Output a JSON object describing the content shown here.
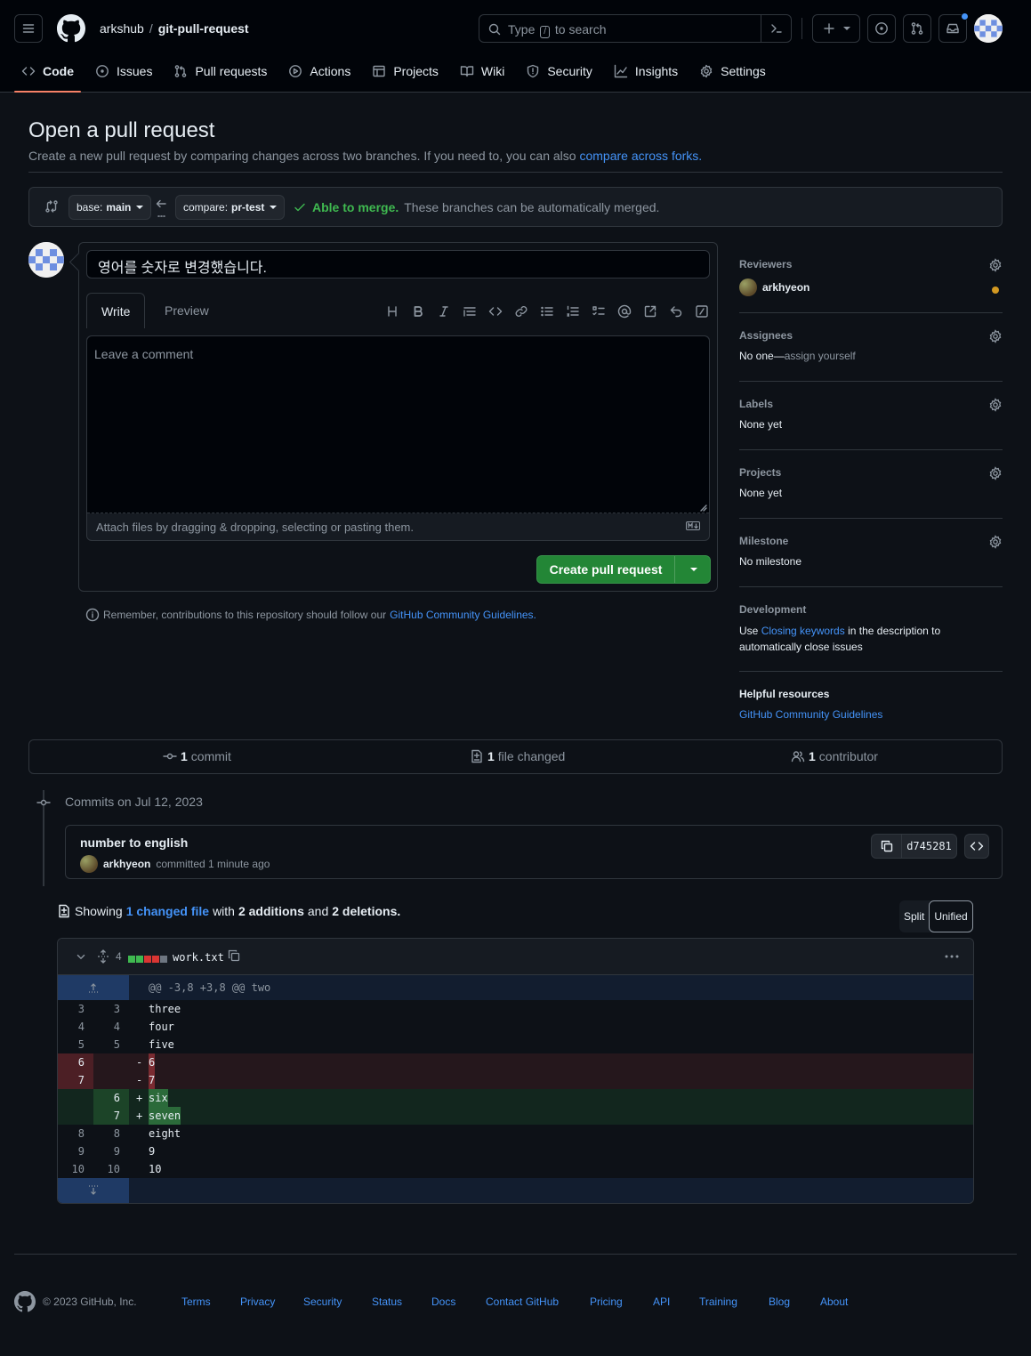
{
  "header": {
    "owner": "arkshub",
    "repo": "git-pull-request",
    "search_prefix": "Type",
    "search_key": "/",
    "search_suffix": "to search"
  },
  "tabs": [
    {
      "label": "Code",
      "icon": "code-icon"
    },
    {
      "label": "Issues",
      "icon": "issue-icon"
    },
    {
      "label": "Pull requests",
      "icon": "pull-request-icon"
    },
    {
      "label": "Actions",
      "icon": "play-icon"
    },
    {
      "label": "Projects",
      "icon": "table-icon"
    },
    {
      "label": "Wiki",
      "icon": "book-icon"
    },
    {
      "label": "Security",
      "icon": "shield-icon"
    },
    {
      "label": "Insights",
      "icon": "graph-icon"
    },
    {
      "label": "Settings",
      "icon": "gear-icon"
    }
  ],
  "page": {
    "title": "Open a pull request",
    "subtitle": "Create a new pull request by comparing changes across two branches. If you need to, you can also",
    "subtitle_link": "compare across forks."
  },
  "range": {
    "base_prefix": "base:",
    "base": "main",
    "compare_prefix": "compare:",
    "compare": "pr-test",
    "merge_status": "Able to merge.",
    "merge_detail": "These branches can be automatically merged."
  },
  "compose": {
    "title_value": "영어를 숫자로 변경했습니다.",
    "tab_write": "Write",
    "tab_preview": "Preview",
    "placeholder": "Leave a comment",
    "attach_hint": "Attach files by dragging & dropping, selecting or pasting them.",
    "create_button": "Create pull request",
    "remember_text": "Remember, contributions to this repository should follow our",
    "remember_link": "GitHub Community Guidelines."
  },
  "sidebar": {
    "reviewers_title": "Reviewers",
    "reviewer_name": "arkhyeon",
    "assignees_title": "Assignees",
    "assignees_value": "No one—",
    "assignees_link": "assign yourself",
    "labels_title": "Labels",
    "labels_value": "None yet",
    "projects_title": "Projects",
    "projects_value": "None yet",
    "milestone_title": "Milestone",
    "milestone_value": "No milestone",
    "development_title": "Development",
    "development_pre": "Use",
    "development_link": "Closing keywords",
    "development_post": "in the description to",
    "development_line2": "automatically close issues",
    "helpful_title": "Helpful resources",
    "helpful_link": "GitHub Community Guidelines"
  },
  "summary": {
    "commits_count": "1",
    "commits_label": "commit",
    "files_count": "1",
    "files_label": "file changed",
    "contributors_count": "1",
    "contributors_label": "contributor"
  },
  "commits": {
    "date_heading": "Commits on Jul 12, 2023",
    "message": "number to english",
    "author": "arkhyeon",
    "meta": "committed 1 minute ago",
    "sha": "d745281"
  },
  "diff": {
    "showing": "Showing",
    "changed_link": "1 changed file",
    "with": "with",
    "additions": "2 additions",
    "and": "and",
    "deletions": "2 deletions.",
    "split_label": "Split",
    "unified_label": "Unified",
    "file_changes": "4",
    "file_name": "work.txt",
    "hunk_header": "@@ -3,8 +3,8 @@ two",
    "lines": [
      {
        "type": "ctx",
        "old": "3",
        "new": "3",
        "sign": " ",
        "text": "three"
      },
      {
        "type": "ctx",
        "old": "4",
        "new": "4",
        "sign": " ",
        "text": "four"
      },
      {
        "type": "ctx",
        "old": "5",
        "new": "5",
        "sign": " ",
        "text": "five"
      },
      {
        "type": "del",
        "old": "6",
        "new": "",
        "sign": "-",
        "text": "6"
      },
      {
        "type": "del",
        "old": "7",
        "new": "",
        "sign": "-",
        "text": "7"
      },
      {
        "type": "add",
        "old": "",
        "new": "6",
        "sign": "+",
        "text": "six"
      },
      {
        "type": "add",
        "old": "",
        "new": "7",
        "sign": "+",
        "text": "seven"
      },
      {
        "type": "ctx",
        "old": "8",
        "new": "8",
        "sign": " ",
        "text": "eight"
      },
      {
        "type": "ctx",
        "old": "9",
        "new": "9",
        "sign": " ",
        "text": "9"
      },
      {
        "type": "ctx",
        "old": "10",
        "new": "10",
        "sign": " ",
        "text": "10"
      }
    ]
  },
  "footer": {
    "copyright": "© 2023 GitHub, Inc.",
    "links": [
      "Terms",
      "Privacy",
      "Security",
      "Status",
      "Docs",
      "Contact GitHub",
      "Pricing",
      "API",
      "Training",
      "Blog",
      "About"
    ]
  },
  "colors": {
    "accent": "#4493f8",
    "merge_ok": "#3fb950",
    "create_button": "#238636",
    "reviewer_pending": "#d29922",
    "tab_underline": "#f78166"
  }
}
